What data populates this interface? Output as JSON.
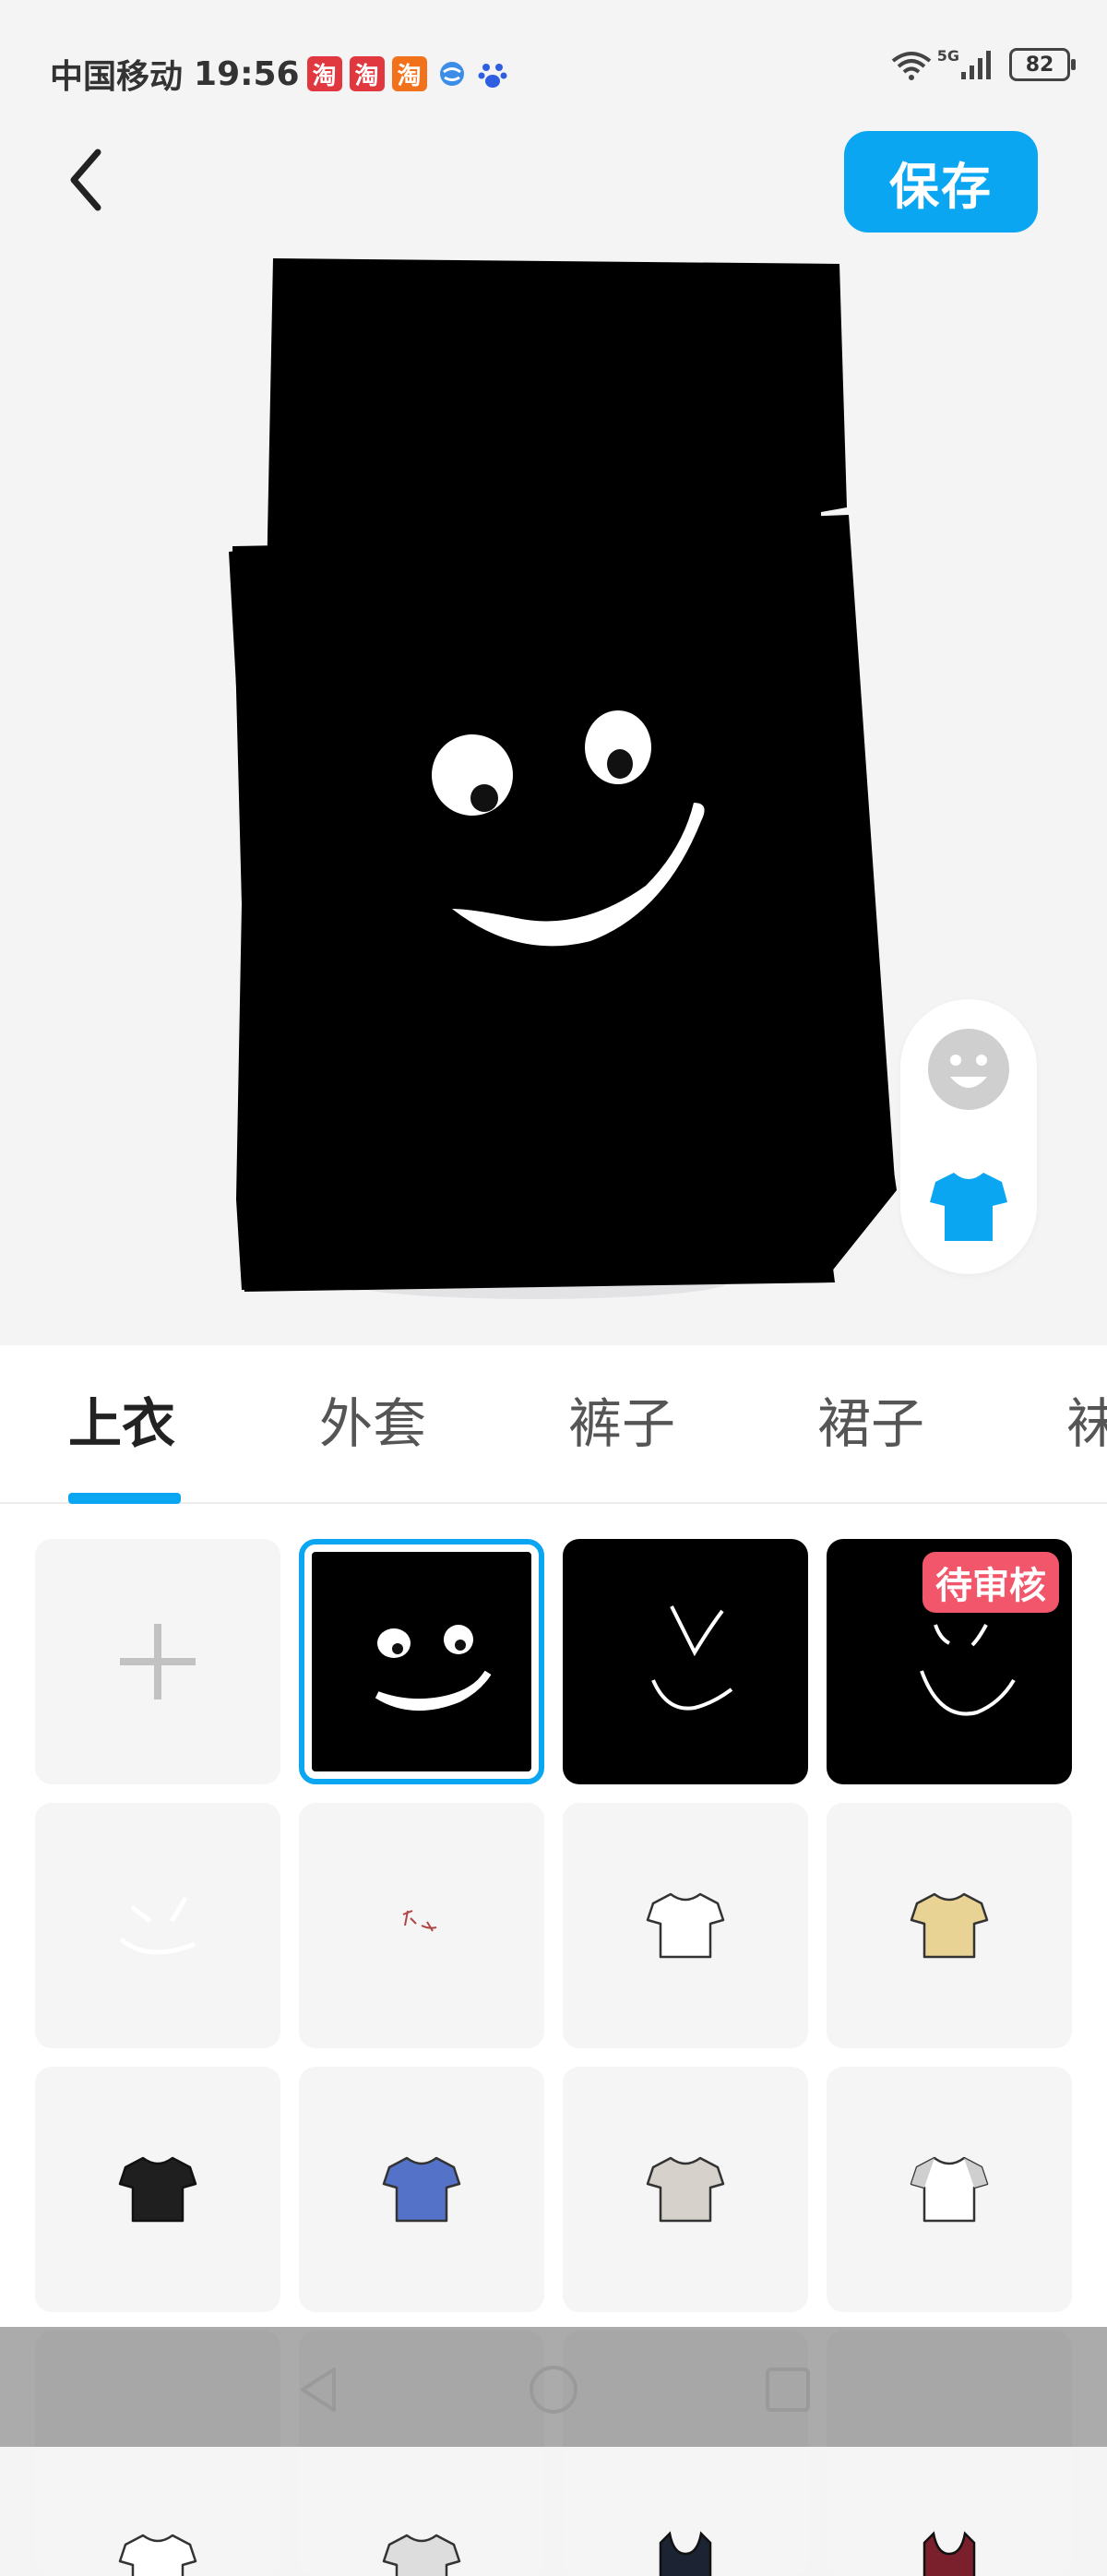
{
  "status_bar": {
    "carrier": "中国移动",
    "time": "19:56",
    "app_badges": [
      {
        "label": "淘",
        "color": "#e0383e"
      },
      {
        "label": "淘",
        "color": "#e0383e"
      },
      {
        "label": "淘",
        "color": "#f2721c"
      }
    ],
    "network": "5G",
    "battery": "82"
  },
  "header": {
    "back_icon": "chevron-left-icon",
    "save_label": "保存"
  },
  "side_toggle": {
    "items": [
      "face-icon",
      "shirt-icon"
    ],
    "active_color": "#0aa6f2"
  },
  "tabs": [
    {
      "label": "上衣",
      "active": true
    },
    {
      "label": "外套",
      "active": false
    },
    {
      "label": "裤子",
      "active": false
    },
    {
      "label": "裙子",
      "active": false
    },
    {
      "label": "袜",
      "active": false
    }
  ],
  "grid": {
    "add_icon": "plus-icon",
    "pending_label": "待审核",
    "items": [
      {
        "type": "add"
      },
      {
        "type": "custom-face-black",
        "selected": true
      },
      {
        "type": "custom-v-black"
      },
      {
        "type": "custom-smile-black",
        "pending": true
      },
      {
        "type": "custom-faint-light"
      },
      {
        "type": "custom-doodle-light"
      },
      {
        "type": "tshirt",
        "color": "#ffffff"
      },
      {
        "type": "tshirt",
        "color": "#e8d394"
      },
      {
        "type": "tshirt",
        "color": "#1f1f1f"
      },
      {
        "type": "tshirt",
        "color": "#5472c8"
      },
      {
        "type": "tshirt",
        "color": "#d7d1cb"
      },
      {
        "type": "tshirt-raglan",
        "color": "#ffffff"
      },
      {
        "type": "tshirt",
        "color": "#ffffff"
      },
      {
        "type": "tshirt",
        "color": "#dddddd"
      },
      {
        "type": "tank",
        "color": "#1c2333"
      },
      {
        "type": "tank",
        "color": "#7a1f2c"
      }
    ]
  },
  "nav_bar": {
    "items": [
      "back-triangle-icon",
      "home-circle-icon",
      "recents-square-icon"
    ]
  },
  "colors": {
    "accent": "#0aa6f2",
    "pending": "#f2566a",
    "background": "#f4f4f5"
  }
}
